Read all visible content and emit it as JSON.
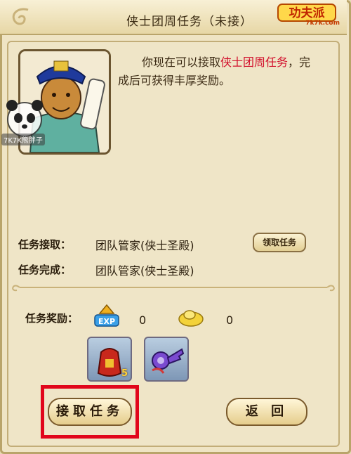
{
  "window": {
    "title": "侠士团周任务（未接）"
  },
  "logo": {
    "text": "7k7k.com"
  },
  "watermark": {
    "text": "7K7K熊胖子"
  },
  "description": {
    "prefix": "你现在可以接取",
    "highlight": "侠士团周任务",
    "suffix": "，完成后可获得丰厚奖励。"
  },
  "accept_row": {
    "label": "任务接取：",
    "value": "团队管家(侠士圣殿)",
    "button": "领取任务"
  },
  "complete_row": {
    "label": "任务完成：",
    "value": "团队管家(侠士圣殿)"
  },
  "rewards": {
    "label": "任务奖励：",
    "exp_value": "0",
    "gold_value": "0",
    "items": [
      {
        "icon": "red-bag-icon",
        "count": "5"
      },
      {
        "icon": "key-item-icon",
        "count": ""
      }
    ]
  },
  "buttons": {
    "accept": "接取任务",
    "back": "返 回"
  },
  "colors": {
    "accent_red": "#d2102c",
    "highlight_border": "#e1061b",
    "frame": "#b9a46a"
  }
}
